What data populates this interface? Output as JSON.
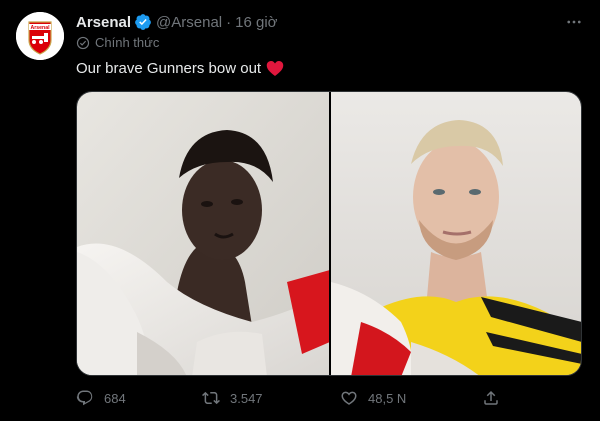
{
  "tweet": {
    "author_name": "Arsenal",
    "author_handle": "@Arsenal",
    "separator": "·",
    "timestamp": "16 giờ",
    "official_label": "Chính thức",
    "text": "Our brave Gunners bow out",
    "avatar_text": "Arsenal",
    "emoji": "red-heart",
    "photos": [
      "photo-player-white-flag",
      "photo-goalkeeper-yellow-kit"
    ]
  },
  "actions": {
    "replies": "684",
    "retweets": "3.547",
    "likes": "48,5 N"
  },
  "icons": {
    "verified": "verified-badge-icon",
    "more": "more-icon",
    "official": "official-check-icon",
    "reply": "reply-icon",
    "retweet": "retweet-icon",
    "like": "heart-icon",
    "share": "share-icon"
  },
  "colors": {
    "background": "#000000",
    "text": "#e7e9ea",
    "secondary": "#71767b",
    "verified": "#1d9bf0",
    "arsenal_red": "#db0007",
    "heart": "#f91880"
  }
}
